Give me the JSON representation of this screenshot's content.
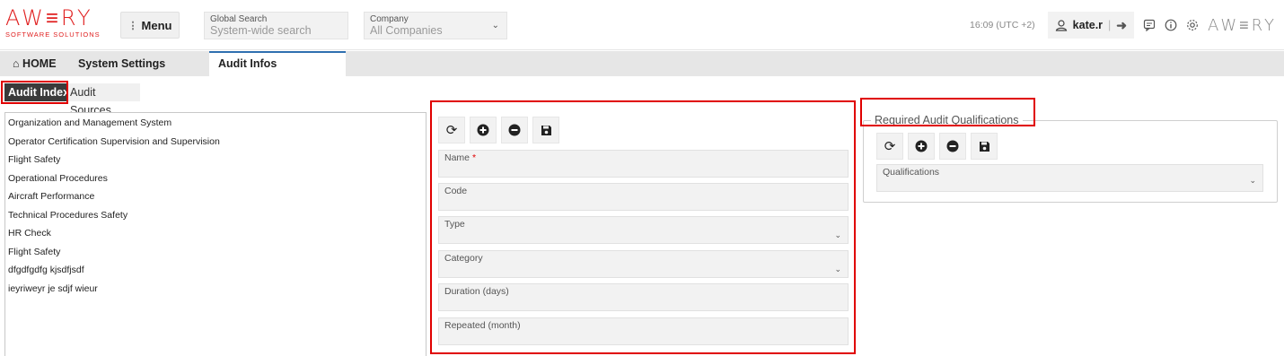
{
  "header": {
    "logo_word": "AW≡RY",
    "logo_sub": "SOFTWARE SOLUTIONS",
    "menu_label": "Menu",
    "global_search_label": "Global Search",
    "global_search_placeholder": "System-wide search",
    "company_label": "Company",
    "company_value": "All Companies",
    "time": "16:09 (UTC +2)",
    "username": "kate.r",
    "brand_right": "AW≡RY"
  },
  "nav": {
    "home": "HOME",
    "system_settings": "System Settings",
    "audit_infos": "Audit Infos"
  },
  "subtabs": {
    "audit_index": "Audit Index",
    "audit_sources": "Audit Sources"
  },
  "audit_list": [
    "Organization and Management System",
    "Operator Certification Supervision and Supervision",
    "Flight Safety",
    "Operational Procedures",
    "Aircraft Performance",
    "Technical Procedures Safety",
    "HR Check",
    "Flight Safety",
    "dfgdfgdfg kjsdfjsdf",
    "ieyriweyr je sdjf wieur"
  ],
  "form": {
    "name_label": "Name",
    "required_mark": "*",
    "code_label": "Code",
    "type_label": "Type",
    "category_label": "Category",
    "duration_label": "Duration (days)",
    "repeated_label": "Repeated (month)"
  },
  "qualifications": {
    "legend": "Required Audit Qualifications",
    "select_label": "Qualifications"
  },
  "colors": {
    "brand_red": "#e02020",
    "highlight_red": "#e00000",
    "active_tab_border": "#2f6fb0"
  }
}
